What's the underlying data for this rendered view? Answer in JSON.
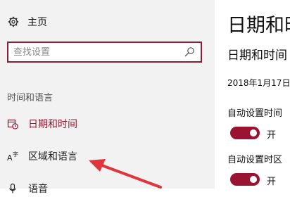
{
  "sidebar": {
    "home_label": "主页",
    "search_placeholder": "查找设置",
    "section_title": "时间和语言",
    "items": [
      {
        "label": "日期和时间",
        "icon": "calendar-clock-icon",
        "active": true
      },
      {
        "label": "区域和语言",
        "icon": "language-icon",
        "active": false
      },
      {
        "label": "语音",
        "icon": "microphone-icon",
        "active": false
      }
    ]
  },
  "main": {
    "title": "日期和时",
    "subtitle": "日期和时间",
    "current_date": "2018年1月17日",
    "auto_time_label": "自动设置时间",
    "auto_time_state": "开",
    "auto_zone_label": "自动设置时区",
    "auto_zone_state": "开"
  },
  "colors": {
    "accent": "#9a1432",
    "sidebar_bg": "#f2f2f2",
    "arrow": "#e0353a"
  }
}
